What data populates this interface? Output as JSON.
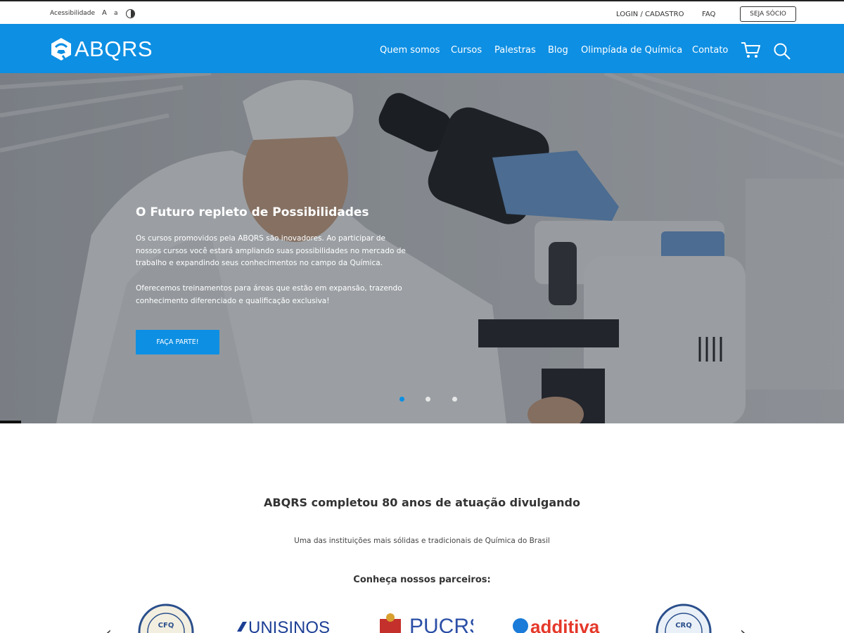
{
  "topbar": {
    "accessibility": "Acessibilidade",
    "font_increase": "A",
    "font_decrease": "a",
    "login": "LOGIN / CADASTRO",
    "faq": "FAQ",
    "member_button": "SEJA SÓCIO"
  },
  "nav": {
    "logo_text": "ABQRS",
    "items": [
      {
        "label": "Quem somos"
      },
      {
        "label": "Cursos"
      },
      {
        "label": "Palestras"
      },
      {
        "label": "Blog"
      },
      {
        "label": "Olimpíada de Química"
      },
      {
        "label": "Contato"
      }
    ],
    "icons": [
      "cart-icon",
      "search-icon"
    ]
  },
  "hero": {
    "title": "O Futuro repleto de Possibilidades",
    "paragraph1": "Os cursos promovidos pela ABQRS são inovadores. Ao participar de nossos cursos você estará ampliando suas possibilidades no mercado de trabalho e expandindo seus conhecimentos no campo da Química.",
    "paragraph2": "Oferecemos treinamentos para áreas que estão em expansão, trazendo conhecimento diferenciado e qualificação exclusiva!",
    "button": "FAÇA PARTE!",
    "slides_total": 3,
    "active_slide": 1
  },
  "intro": {
    "headline": "ABQRS completou 80 anos de atuação divulgando",
    "subheadline": "Uma das instituições mais sólidas e tradicionais de Química do Brasil",
    "partners_title": "Conheça nossos parceiros:"
  },
  "partners": {
    "prev": "‹",
    "next": "›",
    "logos": [
      {
        "name": "CFQ",
        "text": "CFQ"
      },
      {
        "name": "UNISINOS",
        "text": "UNISINOS"
      },
      {
        "name": "PUCRS",
        "text": "PUCRS"
      },
      {
        "name": "additiva",
        "text": "additiva"
      },
      {
        "name": "CRQ",
        "text": "CRQ"
      }
    ]
  },
  "colors": {
    "brand_blue": "#0d8fe3",
    "text_dark": "#333333"
  }
}
